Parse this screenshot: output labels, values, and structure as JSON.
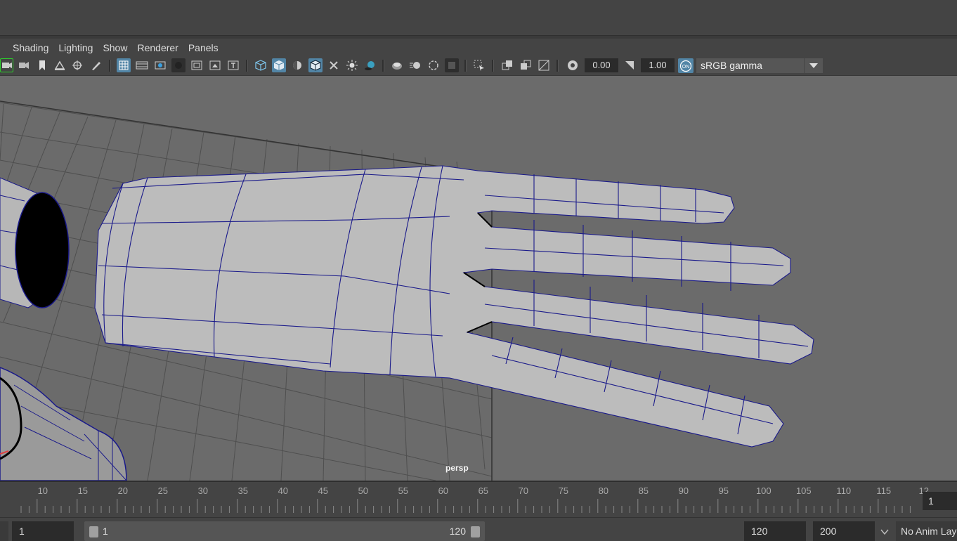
{
  "menubar": {
    "items": [
      "Shading",
      "Lighting",
      "Show",
      "Renderer",
      "Panels"
    ]
  },
  "toolbar": {
    "icons": [
      "camera-select-icon",
      "camera-attributes-icon",
      "bookmark-icon",
      "image-plane-icon",
      "2d-pan-zoom-icon",
      "grease-pencil-icon",
      "grid-icon",
      "film-gate-icon",
      "resolution-gate-icon",
      "gate-mask-icon",
      "field-chart-icon",
      "safe-action-icon",
      "safe-title-icon",
      "wireframe-icon",
      "smooth-shade-icon",
      "default-material-icon",
      "wireframe-on-shaded-icon",
      "xray-icon",
      "use-all-lights-icon",
      "shadows-icon",
      "screen-space-ao-icon",
      "motion-blur-icon",
      "anti-aliasing-icon",
      "depth-of-field-icon",
      "isolate-select-icon",
      "xray-joints-icon",
      "xray-active-icon",
      "texture-icon",
      "exposure-icon",
      "gamma-icon"
    ],
    "exposure_value": "0.00",
    "gamma_value": "1.00",
    "color_management_badge": "ON",
    "color_space": "sRGB gamma"
  },
  "viewport": {
    "camera_label": "persp"
  },
  "timeline": {
    "tick_labels": [
      "10",
      "15",
      "20",
      "25",
      "30",
      "35",
      "40",
      "45",
      "50",
      "55",
      "60",
      "65",
      "70",
      "75",
      "80",
      "85",
      "90",
      "95",
      "100",
      "105",
      "110",
      "115",
      "12"
    ],
    "current_frame": "1"
  },
  "range": {
    "start_frame": "1",
    "range_start": "1",
    "range_end": "120",
    "end_frame": "120",
    "max_frame": "200",
    "anim_layer": "No Anim Lay"
  },
  "colors": {
    "accent": "#5285a6",
    "viewport_bg": "#6b6b6b",
    "wire": "#1a1a8a"
  }
}
